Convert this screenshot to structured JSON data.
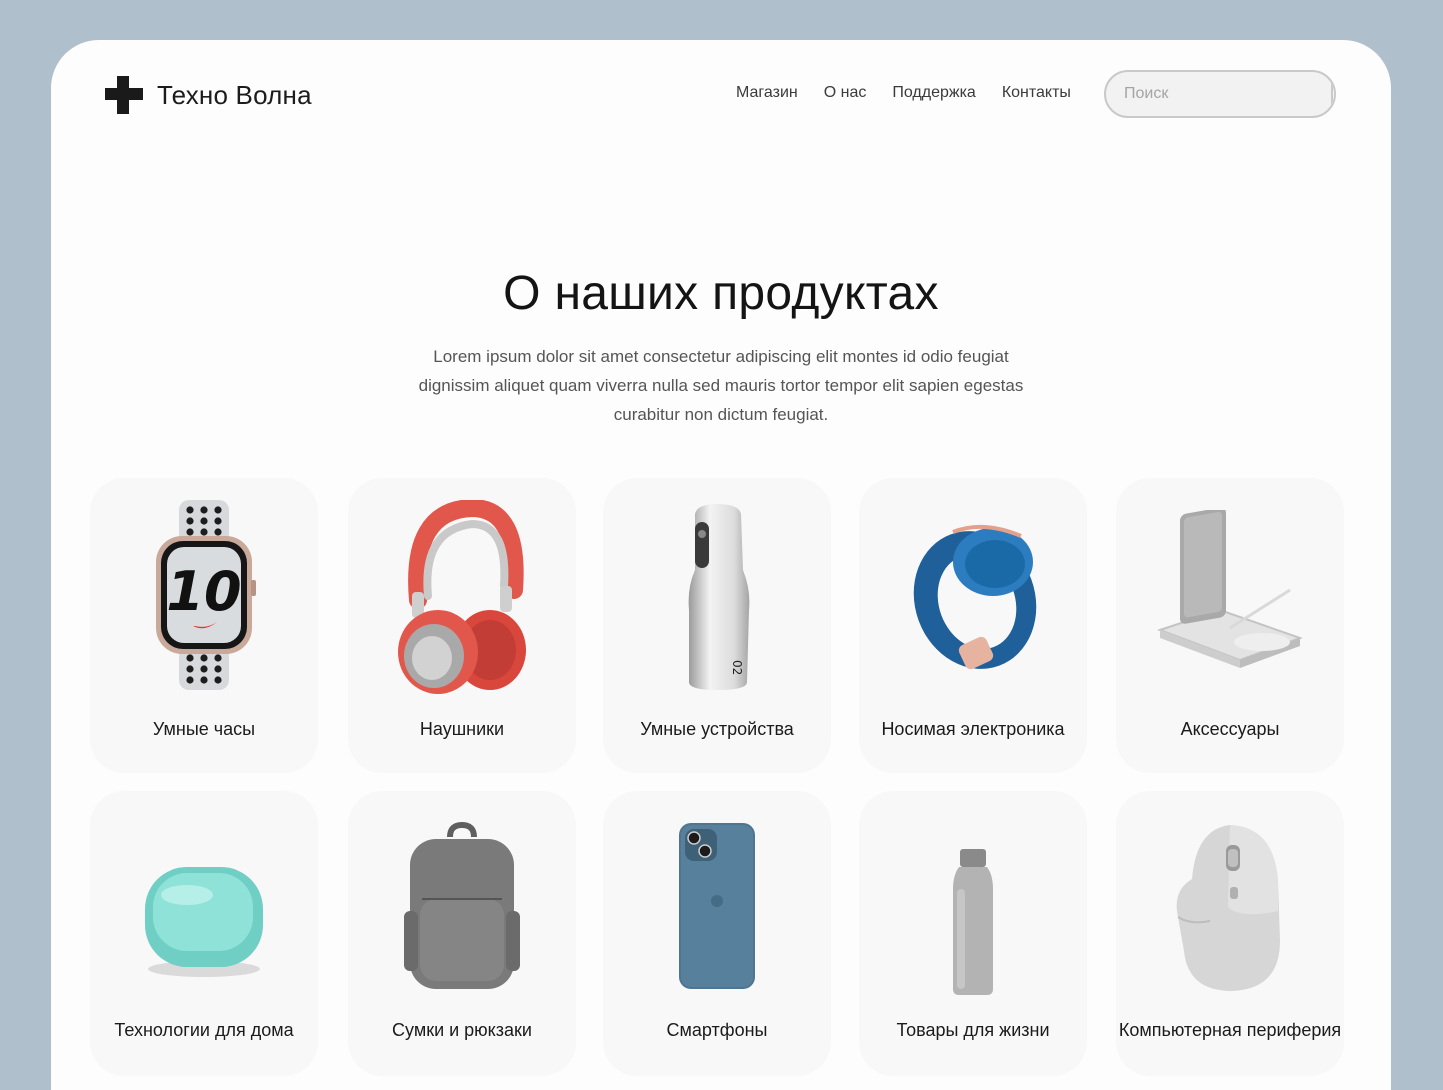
{
  "brand": {
    "name": "Техно Волна"
  },
  "nav": {
    "items": [
      "Магазин",
      "О нас",
      "Поддержка",
      "Контакты"
    ]
  },
  "search": {
    "placeholder": "Поиск",
    "value": ""
  },
  "hero": {
    "title": "О наших продуктах",
    "description": "Lorem ipsum dolor sit amet consectetur adipiscing elit montes id odio feugiat dignissim aliquet quam viverra nulla sed mauris tortor tempor elit sapien egestas curabitur non dictum feugiat."
  },
  "categories": [
    {
      "label": "Умные часы",
      "icon": "smartwatch-image"
    },
    {
      "label": "Наушники",
      "icon": "headphones-image"
    },
    {
      "label": "Умные устройства",
      "icon": "smart-device-image"
    },
    {
      "label": "Носимая электроника",
      "icon": "wearable-band-image"
    },
    {
      "label": "Аксессуары",
      "icon": "wireless-charger-image"
    },
    {
      "label": "Технологии для дома",
      "icon": "home-speaker-image"
    },
    {
      "label": "Сумки и рюкзаки",
      "icon": "backpack-image"
    },
    {
      "label": "Смартфоны",
      "icon": "smartphone-image"
    },
    {
      "label": "Товары для жизни",
      "icon": "water-bottle-image"
    },
    {
      "label": "Компьютерная периферия",
      "icon": "computer-mouse-image"
    }
  ],
  "colors": {
    "page_background": "#afbfcb",
    "window_background": "#fdfdfd",
    "card_background": "#f8f8f8",
    "headphones_accent": "#e2574c",
    "band_blue": "#1f5f9a",
    "speaker_teal": "#7fd6cc",
    "phone_blue": "#4f7590"
  }
}
